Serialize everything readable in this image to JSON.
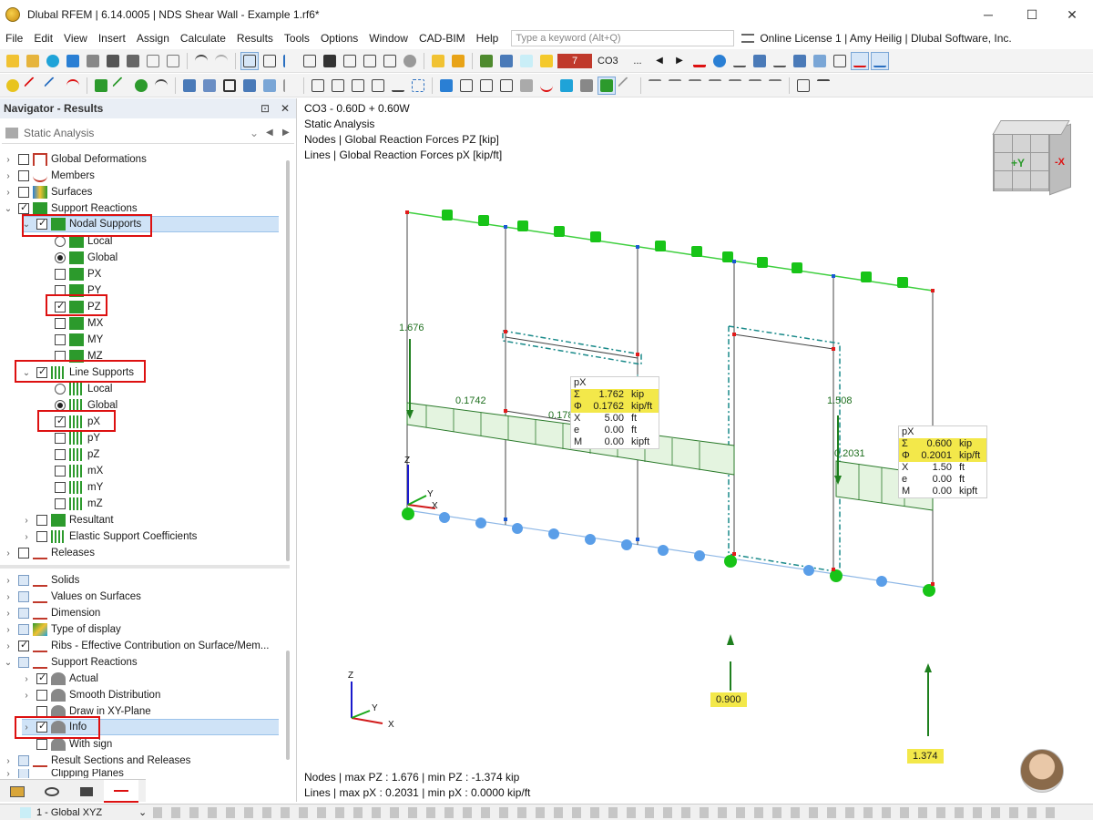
{
  "window": {
    "title": "Dlubal RFEM | 6.14.0005 | NDS Shear Wall - Example 1.rf6*",
    "minimize_glyph": "─",
    "maximize_glyph": "☐",
    "close_glyph": "✕"
  },
  "menu": {
    "items": [
      "File",
      "Edit",
      "View",
      "Insert",
      "Assign",
      "Calculate",
      "Results",
      "Tools",
      "Options",
      "Window",
      "CAD-BIM",
      "Help"
    ],
    "search_placeholder": "Type a keyword (Alt+Q)",
    "license": "Online License 1 | Amy Heilig | Dlubal Software, Inc."
  },
  "toolbar": {
    "load_combo_number": "7",
    "load_combo_name": "CO3",
    "load_combo_more": "..."
  },
  "navigator": {
    "title": "Navigator - Results",
    "combo_value": "Static Analysis",
    "items": [
      {
        "label": "Global Deformations"
      },
      {
        "label": "Members"
      },
      {
        "label": "Surfaces"
      },
      {
        "label": "Support Reactions"
      },
      {
        "label": "Nodal Supports"
      },
      {
        "label": "Local"
      },
      {
        "label": "Global"
      },
      {
        "label": "PX"
      },
      {
        "label": "PY"
      },
      {
        "label": "PZ"
      },
      {
        "label": "MX"
      },
      {
        "label": "MY"
      },
      {
        "label": "MZ"
      },
      {
        "label": "Line Supports"
      },
      {
        "label": "Local"
      },
      {
        "label": "Global"
      },
      {
        "label": "pX"
      },
      {
        "label": "pY"
      },
      {
        "label": "pZ"
      },
      {
        "label": "mX"
      },
      {
        "label": "mY"
      },
      {
        "label": "mZ"
      },
      {
        "label": "Resultant"
      },
      {
        "label": "Elastic Support Coefficients"
      },
      {
        "label": "Releases"
      },
      {
        "label": "Solids"
      },
      {
        "label": "Values on Surfaces"
      },
      {
        "label": "Dimension"
      },
      {
        "label": "Type of display"
      },
      {
        "label": "Ribs - Effective Contribution on Surface/Mem..."
      },
      {
        "label": "Support Reactions"
      },
      {
        "label": "Actual"
      },
      {
        "label": "Smooth Distribution"
      },
      {
        "label": "Draw in XY-Plane"
      },
      {
        "label": "Info"
      },
      {
        "label": "With sign"
      },
      {
        "label": "Result Sections and Releases"
      },
      {
        "label": "Clipping Planes"
      }
    ]
  },
  "status": {
    "view_combo": "1 - Global XYZ"
  },
  "viewport": {
    "header": [
      "CO3 - 0.60D + 0.60W",
      "Static Analysis",
      "Nodes | Global Reaction Forces PZ [kip]",
      "Lines | Global Reaction Forces pX [kip/ft]"
    ],
    "footer": [
      "Nodes | max PZ : 1.676 | min PZ : -1.374 kip",
      "Lines | max pX : 0.2031 | min pX : 0.0000 kip/ft"
    ],
    "values": {
      "v1676": "1.676",
      "v1742": "0.1742",
      "v1786": "0.1786",
      "v1508": "1.508",
      "v2031": "0.2031",
      "v900": "0.900",
      "v1374": "1.374"
    },
    "cube": {
      "plus_y": "+Y",
      "minus_x": "-X"
    },
    "axes": {
      "x": "X",
      "y": "Y",
      "z": "Z"
    },
    "info1": {
      "title": "pX",
      "rows": [
        {
          "sym": "Σ",
          "val": "1.762",
          "unit": "kip",
          "hl": true
        },
        {
          "sym": "Φ",
          "val": "0.1762",
          "unit": "kip/ft",
          "hl": true
        },
        {
          "sym": "X",
          "val": "5.00",
          "unit": "ft",
          "hl": false
        },
        {
          "sym": "e",
          "val": "0.00",
          "unit": "ft",
          "hl": false
        },
        {
          "sym": "M",
          "val": "0.00",
          "unit": "kipft",
          "hl": false
        }
      ]
    },
    "info2": {
      "title": "pX",
      "rows": [
        {
          "sym": "Σ",
          "val": "0.600",
          "unit": "kip",
          "hl": true
        },
        {
          "sym": "Φ",
          "val": "0.2001",
          "unit": "kip/ft",
          "hl": true
        },
        {
          "sym": "X",
          "val": "1.50",
          "unit": "ft",
          "hl": false
        },
        {
          "sym": "e",
          "val": "0.00",
          "unit": "ft",
          "hl": false
        },
        {
          "sym": "M",
          "val": "0.00",
          "unit": "kipft",
          "hl": false
        }
      ]
    }
  },
  "colors": {
    "accent_red": "#d11a1a",
    "support_green": "#1fb61f",
    "load_green": "#1e7f1e",
    "highlight_yellow": "#f3e84a",
    "selection_blue": "#cfe3f7"
  }
}
